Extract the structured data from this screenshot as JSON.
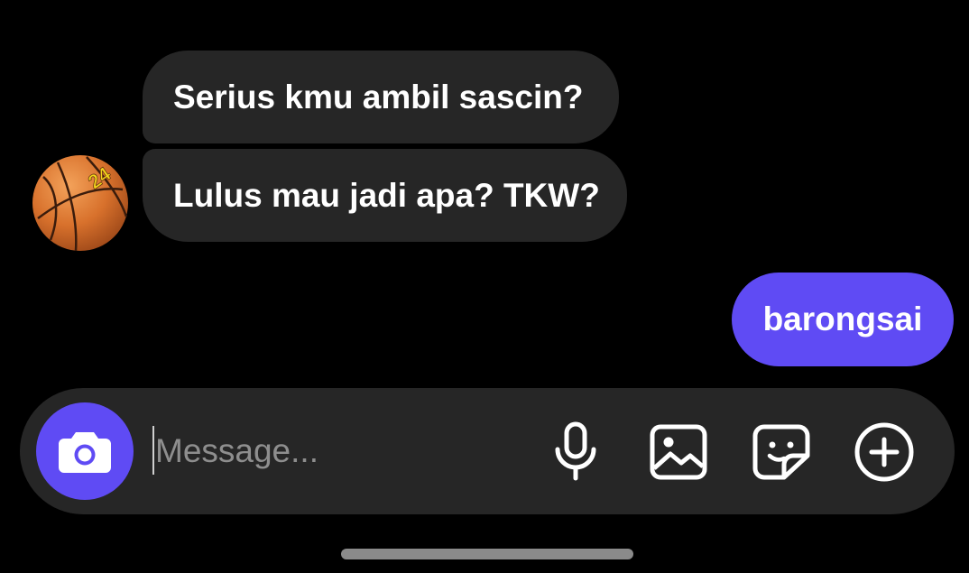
{
  "conversation": {
    "messages": [
      {
        "sender": "other",
        "text": "Serius kmu ambil sascin?"
      },
      {
        "sender": "other",
        "text": "Lulus mau jadi apa? TKW?"
      },
      {
        "sender": "me",
        "text": "barongsai"
      }
    ],
    "avatar": {
      "icon": "basketball-icon",
      "jersey_number": "24"
    }
  },
  "composer": {
    "placeholder": "Message...",
    "value": "",
    "buttons": {
      "camera": "camera-icon",
      "mic": "microphone-icon",
      "gallery": "image-icon",
      "sticker": "sticker-icon",
      "more": "plus-icon"
    }
  },
  "colors": {
    "background": "#000000",
    "incoming_bubble": "#262626",
    "outgoing_bubble": "#5f4bf4",
    "accent": "#5f4bf4",
    "placeholder": "#8e8e8e"
  }
}
